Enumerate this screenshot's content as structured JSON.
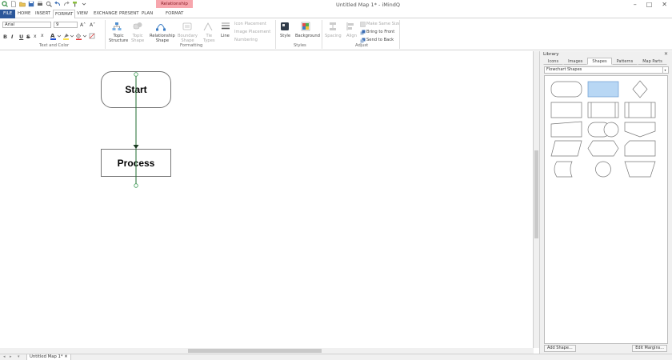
{
  "window": {
    "title": "Untitled Map 1* - iMindQ",
    "context_tab": "Relationship",
    "controls": [
      "–",
      "□",
      "✕"
    ]
  },
  "tabs": [
    {
      "label": "FILE"
    },
    {
      "label": "HOME"
    },
    {
      "label": "INSERT"
    },
    {
      "label": "FORMAT"
    },
    {
      "label": "VIEW"
    },
    {
      "label": "EXCHANGE"
    },
    {
      "label": "PRESENT"
    },
    {
      "label": "PLAN"
    },
    {
      "label": "FORMAT"
    }
  ],
  "ribbon": {
    "font_name": "Arial",
    "font_size": "9",
    "text_color_group": "Text and Color",
    "formatting_group": "Formatting",
    "styles_group": "Styles",
    "adjust_group": "Adjust",
    "topic_structure": "Topic\nStructure",
    "topic_shape": "Topic\nShape",
    "relationship_shape": "Relationship\nShape",
    "boundary_shape": "Boundary\nShape",
    "tie_types": "Tie\nTypes",
    "line": "Line",
    "icon_placement": "Icon Placement",
    "image_placement": "Image Placement",
    "numbering": "Numbering",
    "style": "Style",
    "background": "Background",
    "spacing": "Spacing",
    "align": "Align",
    "make_same_size": "Make Same Size",
    "bring_to_front": "Bring to Front",
    "send_to_back": "Send to Back",
    "bold": "B",
    "italic": "I",
    "underline": "U",
    "strike": "S",
    "subscript": "x",
    "superscript": "x"
  },
  "canvas": {
    "topics": [
      {
        "label": "Start"
      },
      {
        "label": "Process"
      }
    ]
  },
  "library": {
    "title": "Library",
    "tabs": [
      "Icons",
      "Images",
      "Shapes",
      "Patterns",
      "Map Parts"
    ],
    "active_tab": "Shapes",
    "selected_category": "Flowchart Shapes",
    "add_shape": "Add Shape...",
    "edit_margins": "Edit Margins...",
    "shapes": [
      "terminator",
      "process",
      "decision",
      "data",
      "predefined-process",
      "internal-storage",
      "document",
      "manual-input",
      "preparation",
      "parallelogram",
      "hexagon",
      "card",
      "stored-data",
      "connector",
      "manual-operation"
    ]
  },
  "status": {
    "doc_tab": "Untitled Map 1*"
  },
  "colors": {
    "file_tab": "#2b579a",
    "context_tab": "#f7a6ad",
    "selected_shape": "#b8d7f4",
    "connector": "#1f6e2f"
  }
}
